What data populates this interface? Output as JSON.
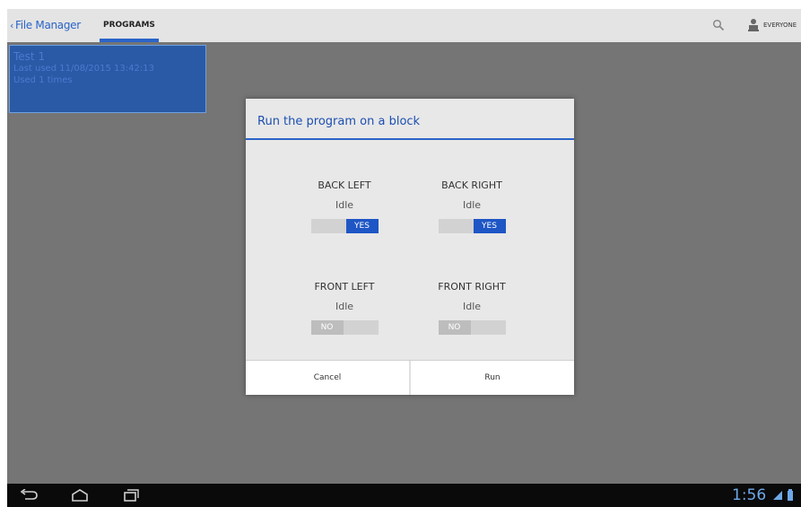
{
  "actionbar": {
    "back_caret": "‹",
    "app_title": "File Manager",
    "tab_programs": "PROGRAMS",
    "user_label": "EVERYONE"
  },
  "program_card": {
    "title": "Test 1",
    "last_used": "Last used 11/08/2015 13:42:13",
    "used_times": "Used 1 times"
  },
  "dialog": {
    "title": "Run the program on a block",
    "blocks": [
      {
        "name": "BACK LEFT",
        "status": "Idle",
        "toggle_label": "YES",
        "enabled": true
      },
      {
        "name": "BACK RIGHT",
        "status": "Idle",
        "toggle_label": "YES",
        "enabled": true
      },
      {
        "name": "FRONT LEFT",
        "status": "Idle",
        "toggle_label": "NO",
        "enabled": false
      },
      {
        "name": "FRONT RIGHT",
        "status": "Idle",
        "toggle_label": "NO",
        "enabled": false
      }
    ],
    "cancel_label": "Cancel",
    "run_label": "Run"
  },
  "navbar": {
    "clock": "1:56"
  },
  "colors": {
    "accent": "#2a64c8",
    "toggle_on": "#1e56c5",
    "dim_background": "#757575"
  },
  "icons": [
    "search-icon",
    "user-icon",
    "back-nav-icon",
    "home-nav-icon",
    "recents-nav-icon",
    "signal-icon",
    "battery-icon"
  ]
}
